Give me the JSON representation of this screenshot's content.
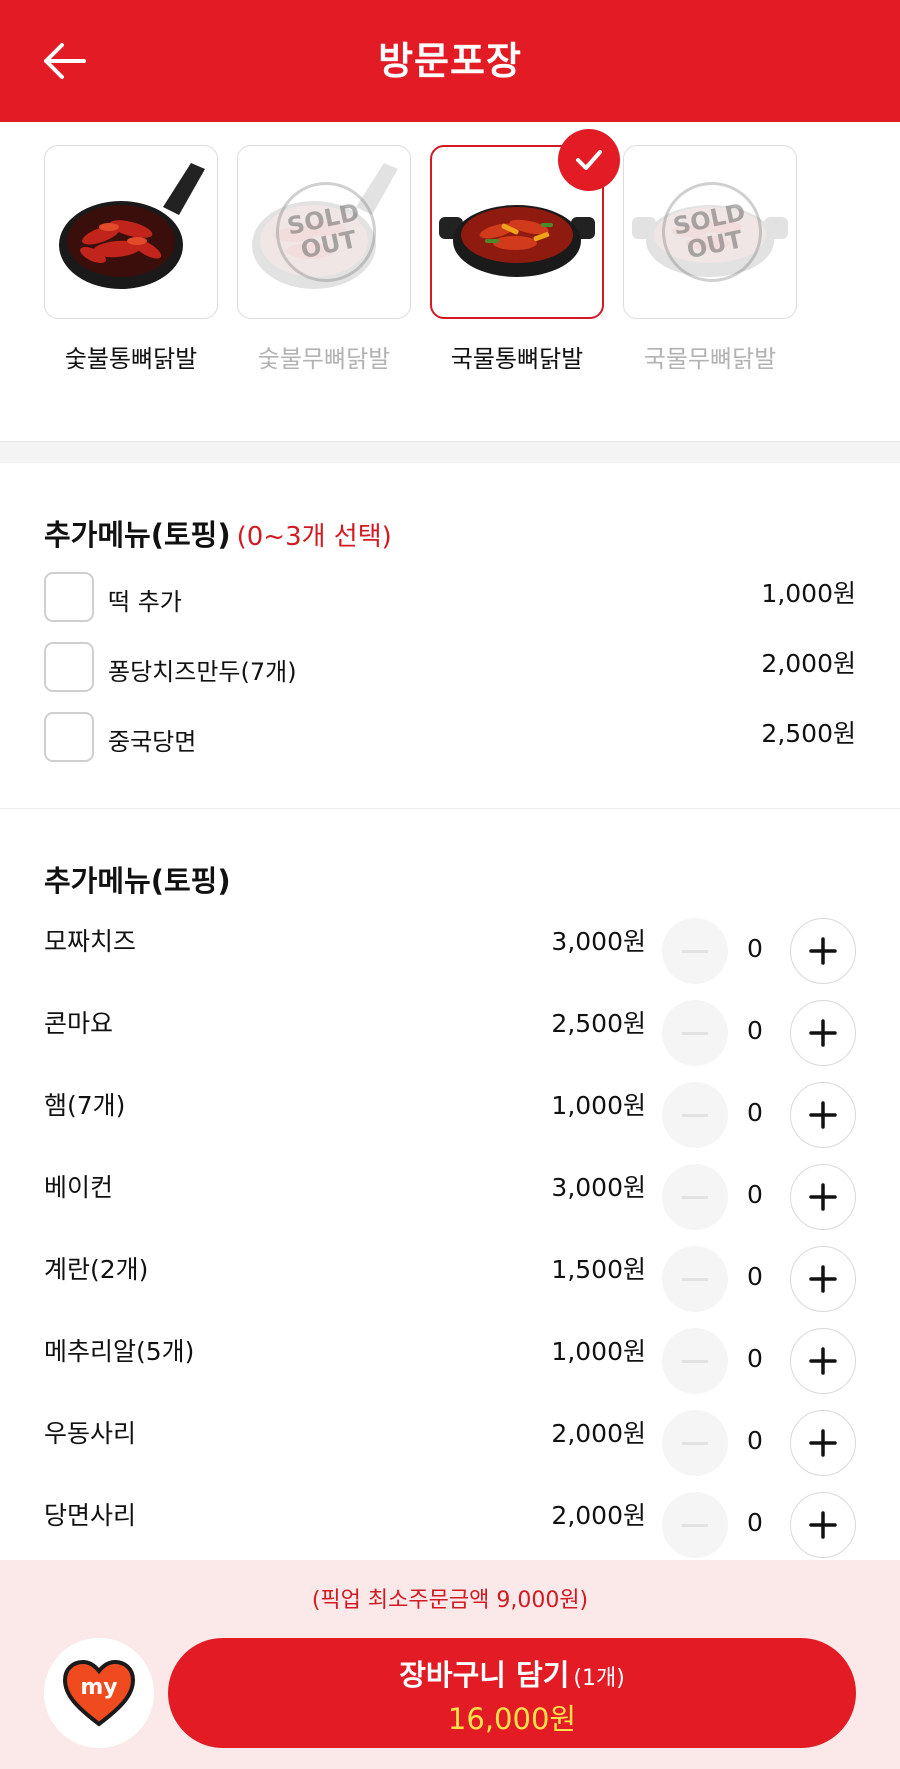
{
  "header": {
    "title": "방문포장",
    "back_icon": "arrow-left-icon"
  },
  "colors": {
    "brand_red": "#e21b25",
    "sub_red": "#d11a22",
    "total_yellow": "#ffe14a",
    "soldout_gray": "#b3b3b3"
  },
  "options": [
    {
      "label": "숯불통뼈닭발",
      "dish": "pan",
      "soldout": false,
      "selected": false
    },
    {
      "label": "숯불무뼈닭발",
      "dish": "pan",
      "soldout": true,
      "selected": false,
      "stamp_line1": "SOLD",
      "stamp_line2": "OUT"
    },
    {
      "label": "국물통뼈닭발",
      "dish": "pot",
      "soldout": false,
      "selected": true
    },
    {
      "label": "국물무뼈닭발",
      "dish": "pot",
      "soldout": true,
      "selected": false,
      "stamp_line1": "SOLD",
      "stamp_line2": "OUT"
    }
  ],
  "checkbox_section": {
    "title": "추가메뉴(토핑)",
    "subtitle": "(0~3개 선택)",
    "items": [
      {
        "label": "떡 추가",
        "price": "1,000원",
        "checked": false
      },
      {
        "label": "퐁당치즈만두(7개)",
        "price": "2,000원",
        "checked": false
      },
      {
        "label": "중국당면",
        "price": "2,500원",
        "checked": false
      }
    ]
  },
  "stepper_section": {
    "title": "추가메뉴(토핑)",
    "items": [
      {
        "label": "모짜치즈",
        "price": "3,000원",
        "qty": "0"
      },
      {
        "label": "콘마요",
        "price": "2,500원",
        "qty": "0"
      },
      {
        "label": "햄(7개)",
        "price": "1,000원",
        "qty": "0"
      },
      {
        "label": "베이컨",
        "price": "3,000원",
        "qty": "0"
      },
      {
        "label": "계란(2개)",
        "price": "1,500원",
        "qty": "0"
      },
      {
        "label": "메추리알(5개)",
        "price": "1,000원",
        "qty": "0"
      },
      {
        "label": "우동사리",
        "price": "2,000원",
        "qty": "0"
      },
      {
        "label": "당면사리",
        "price": "2,000원",
        "qty": "0"
      }
    ]
  },
  "bottom": {
    "min_order": "(픽업 최소주문금액 9,000원)",
    "my_badge_text": "my",
    "cart_label": "장바구니 담기",
    "cart_count": "(1개)",
    "total": "16,000원"
  }
}
